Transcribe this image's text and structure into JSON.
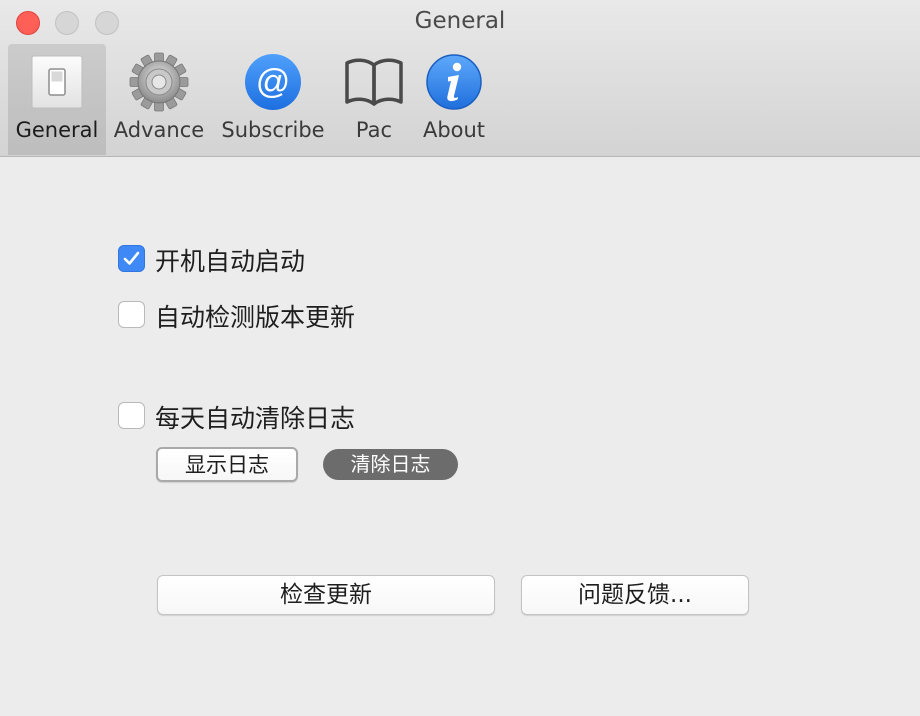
{
  "window": {
    "title": "General"
  },
  "toolbar": {
    "items": [
      {
        "label": "General",
        "icon": "switch-icon"
      },
      {
        "label": "Advance",
        "icon": "gear-icon"
      },
      {
        "label": "Subscribe",
        "icon": "at-sign-icon"
      },
      {
        "label": "Pac",
        "icon": "book-icon"
      },
      {
        "label": "About",
        "icon": "info-icon"
      }
    ],
    "selected": "General"
  },
  "options": {
    "launch_at_login": {
      "label": "开机自动启动",
      "checked": true
    },
    "auto_check_updates": {
      "label": "自动检测版本更新",
      "checked": false
    },
    "daily_clear_logs": {
      "label": "每天自动清除日志",
      "checked": false
    }
  },
  "buttons": {
    "show_log": "显示日志",
    "clear_log": "清除日志",
    "check_update": "检查更新",
    "feedback": "问题反馈..."
  },
  "colors": {
    "accent": "#3e89f5",
    "close": "#fe5f57",
    "clear_button": "#6c6c6c",
    "window_bg": "#ececec"
  }
}
